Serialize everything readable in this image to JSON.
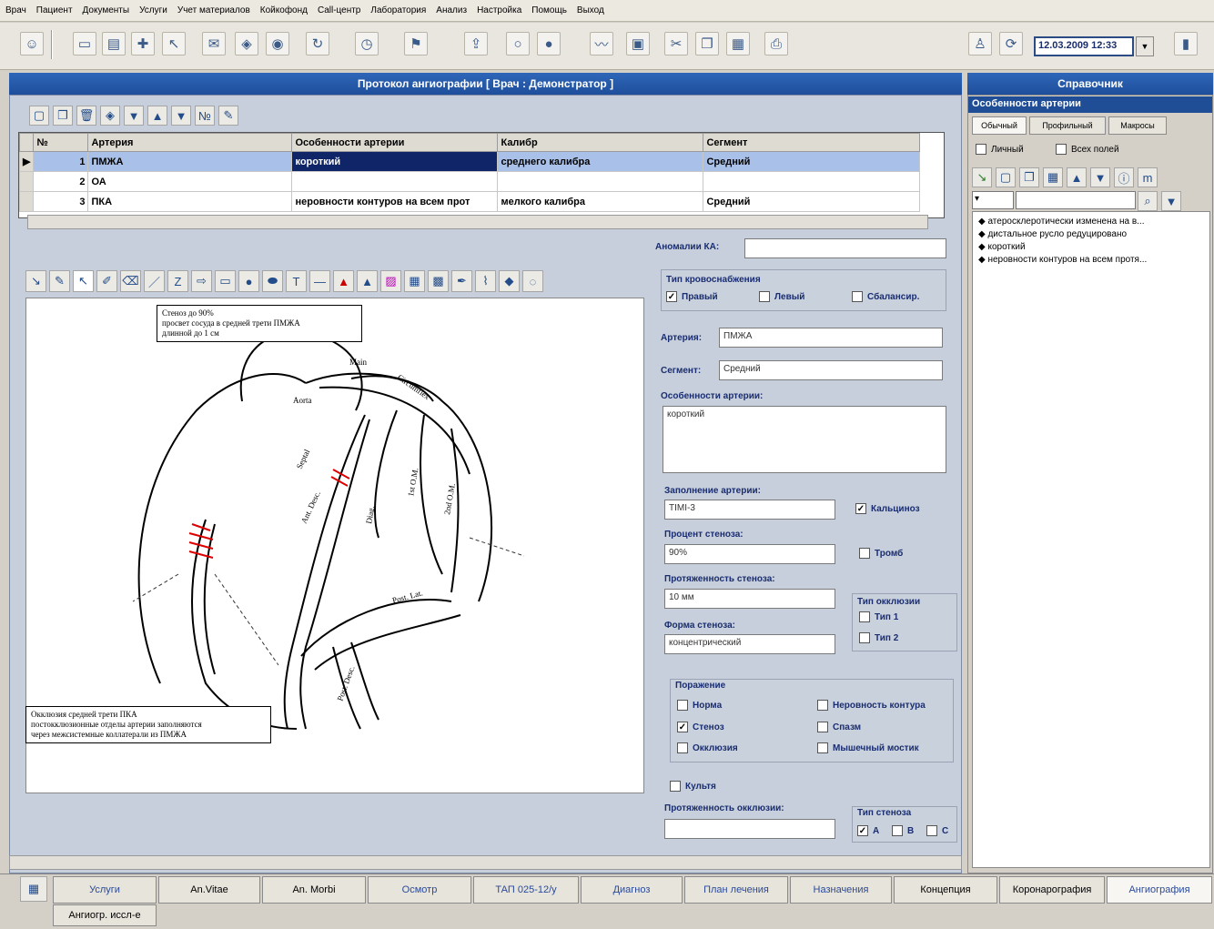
{
  "menu": [
    "Врач",
    "Пациент",
    "Документы",
    "Услуги",
    "Учет материалов",
    "Койкофонд",
    "Call-центр",
    "Лаборатория",
    "Анализ",
    "Настройка",
    "Помощь",
    "Выход"
  ],
  "toolbar": {
    "datetime": "12.03.2009 12:33"
  },
  "protocol": {
    "title": "Протокол ангиографии  [ Врач : Демонстратор ]",
    "grid": {
      "columns": [
        "№",
        "Артерия",
        "Особенности артерии",
        "Калибр",
        "Сегмент"
      ],
      "rows": [
        {
          "num": "1",
          "artery": "ПМЖА",
          "feature": "короткий",
          "caliber": "среднего калибра",
          "segment": "Средний"
        },
        {
          "num": "2",
          "artery": "ОА",
          "feature": "",
          "caliber": "",
          "segment": ""
        },
        {
          "num": "3",
          "artery": "ПКА",
          "feature": "неровности контуров на всем прот",
          "caliber": "мелкого калибра",
          "segment": "Средний"
        }
      ]
    },
    "diagram": {
      "note_top": [
        "Стеноз до 90%",
        "просвет сосуда в средней трети ПМЖА",
        "длинной до 1 см"
      ],
      "note_bottom": [
        "Окклюзия средней трети ПКА",
        "постокклюзионные отделы артерии заполняются",
        "через межсистемные коллатерали из ПМЖА"
      ],
      "labels": {
        "main": "Main",
        "circumflex": "Circumflex",
        "aorta": "Aorta",
        "septal": "Septal",
        "ant_desc": "Ant. Desc.",
        "diag": "Diag.",
        "om1": "1st O.M.",
        "om2": "2nd O.M.",
        "post_lat": "Post. Lat.",
        "post_desc": "Post. Desc."
      }
    },
    "form": {
      "anomalies_label": "Аномалии КА:",
      "anomalies_value": "",
      "blood_supply_title": "Тип кровоснабжения",
      "blood_supply": [
        {
          "label": "Правый",
          "checked": true
        },
        {
          "label": "Левый",
          "checked": false
        },
        {
          "label": "Сбалансир.",
          "checked": false
        }
      ],
      "artery_label": "Артерия:",
      "artery_value": "ПМЖА",
      "segment_label": "Сегмент:",
      "segment_value": "Средний",
      "features_label": "Особенности артерии:",
      "features_value": "короткий",
      "filling_label": "Заполнение артерии:",
      "filling_value": "TIMI-3",
      "calcinosis_label": "Кальциноз",
      "calcinosis_checked": true,
      "stenosis_percent_label": "Процент стеноза:",
      "stenosis_percent_value": "90%",
      "thrombus_label": "Тромб",
      "thrombus_checked": false,
      "stenosis_length_label": "Протяженность стеноза:",
      "stenosis_length_value": "10 мм",
      "occlusion_type_title": "Тип окклюзии",
      "occlusion_type": [
        {
          "label": "Тип 1",
          "checked": false
        },
        {
          "label": "Тип 2",
          "checked": false
        }
      ],
      "stenosis_shape_label": "Форма стеноза:",
      "stenosis_shape_value": "концентрический",
      "lesion_title": "Поражение",
      "lesion": [
        {
          "label": "Норма",
          "checked": false
        },
        {
          "label": "Неровность контура",
          "checked": false
        },
        {
          "label": "Стеноз",
          "checked": true
        },
        {
          "label": "Спазм",
          "checked": false
        },
        {
          "label": "Окклюзия",
          "checked": false
        },
        {
          "label": "Мышечный мостик",
          "checked": false
        }
      ],
      "stump_label": "Культя",
      "stump_checked": false,
      "occlusion_length_label": "Протяженность окклюзии:",
      "occlusion_length_value": "",
      "stenosis_type_title": "Тип стеноза",
      "stenosis_type": [
        {
          "label": "A",
          "checked": true
        },
        {
          "label": "B",
          "checked": false
        },
        {
          "label": "C",
          "checked": false
        }
      ]
    }
  },
  "reference": {
    "title": "Справочник",
    "subtitle": "Особенности артерии",
    "tabs": [
      "Обычный",
      "Профильный",
      "Макросы"
    ],
    "personal_label": "Личный",
    "all_fields_label": "Всех полей",
    "items": [
      "атеросклеротически изменена на в...",
      "дистальное русло редуцировано",
      "короткий",
      "неровности контуров на всем протя..."
    ]
  },
  "bottom_tabs": [
    "Услуги",
    "An.Vitae",
    "An. Morbi",
    "Осмотр",
    "ТАП 025-12/у",
    "Диагноз",
    "План лечения",
    "Назначения",
    "Концепция",
    "Коронарография",
    "Ангиография"
  ],
  "bottom_tab_row2": "Ангиогр. иссл-е",
  "active_tab": "Ангиография"
}
